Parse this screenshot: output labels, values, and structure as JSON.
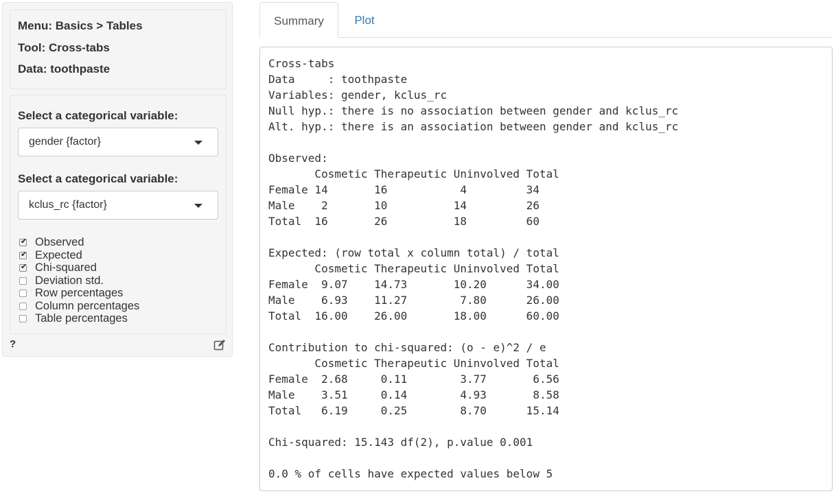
{
  "sidebar": {
    "info": {
      "menu": "Menu: Basics > Tables",
      "tool": "Tool: Cross-tabs",
      "data": "Data: toothpaste"
    },
    "select1": {
      "label": "Select a categorical variable:",
      "value": "gender {factor}"
    },
    "select2": {
      "label": "Select a categorical variable:",
      "value": "kclus_rc {factor}"
    },
    "checkboxes": [
      {
        "label": "Observed",
        "checked": true
      },
      {
        "label": "Expected",
        "checked": true
      },
      {
        "label": "Chi-squared",
        "checked": true
      },
      {
        "label": "Deviation std.",
        "checked": false
      },
      {
        "label": "Row percentages",
        "checked": false
      },
      {
        "label": "Column percentages",
        "checked": false
      },
      {
        "label": "Table percentages",
        "checked": false
      }
    ],
    "help_label": "?",
    "icons": {
      "help": "question-mark",
      "report": "edit-icon"
    }
  },
  "tabs": [
    {
      "label": "Summary",
      "active": true
    },
    {
      "label": "Plot",
      "active": false
    }
  ],
  "colors": {
    "link": "#337ab7",
    "well_bg": "#f5f5f5",
    "border": "#cccccc"
  },
  "output": {
    "text": "Cross-tabs\nData     : toothpaste\nVariables: gender, kclus_rc\nNull hyp.: there is no association between gender and kclus_rc\nAlt. hyp.: there is an association between gender and kclus_rc\n\nObserved:\n       Cosmetic Therapeutic Uninvolved Total\nFemale 14       16           4         34\nMale    2       10          14         26\nTotal  16       26          18         60\n\nExpected: (row total x column total) / total\n       Cosmetic Therapeutic Uninvolved Total\nFemale  9.07    14.73       10.20      34.00\nMale    6.93    11.27        7.80      26.00\nTotal  16.00    26.00       18.00      60.00\n\nContribution to chi-squared: (o - e)^2 / e\n       Cosmetic Therapeutic Uninvolved Total\nFemale  2.68     0.11        3.77       6.56\nMale    3.51     0.14        4.93       8.58\nTotal   6.19     0.25        8.70      15.14\n\nChi-squared: 15.143 df(2), p.value 0.001\n\n0.0 % of cells have expected values below 5"
  }
}
